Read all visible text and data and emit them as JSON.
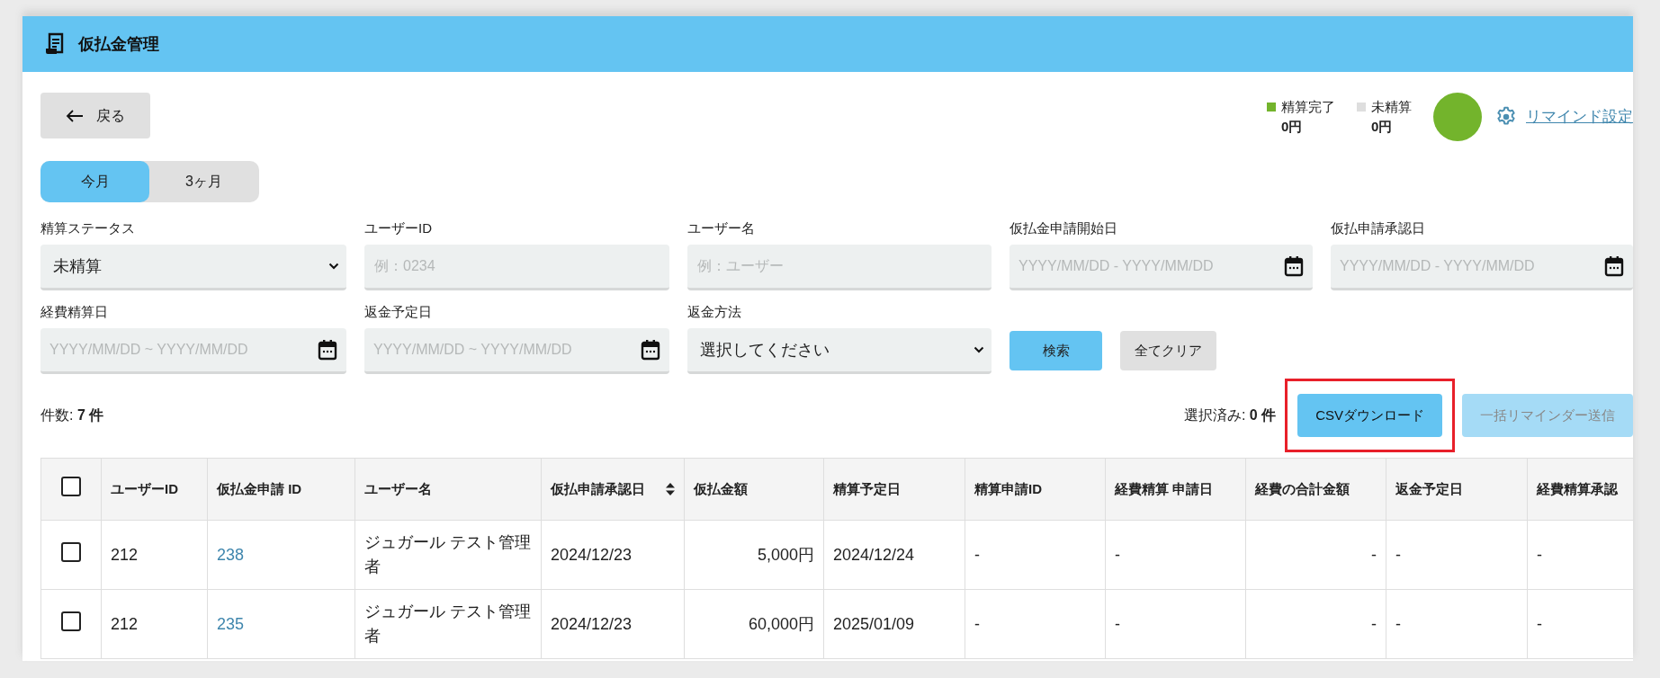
{
  "header": {
    "title": "仮払金管理"
  },
  "back_button": {
    "label": "戻る"
  },
  "summary": {
    "legend": [
      {
        "label": "精算完了",
        "amount": "0円",
        "color": "#73b42c"
      },
      {
        "label": "未精算",
        "amount": "0円",
        "color": "#dedede"
      }
    ],
    "remind_link": "リマインド設定"
  },
  "period_tabs": [
    {
      "label": "今月",
      "selected": true
    },
    {
      "label": "3ヶ月",
      "selected": false
    }
  ],
  "filters": [
    {
      "label": "精算ステータス",
      "kind": "select",
      "value": "未精算"
    },
    {
      "label": "ユーザーID",
      "kind": "text",
      "placeholder": "例：0234"
    },
    {
      "label": "ユーザー名",
      "kind": "text",
      "placeholder": "例：ユーザー"
    },
    {
      "label": "仮払金申請開始日",
      "kind": "date",
      "placeholder": "YYYY/MM/DD - YYYY/MM/DD"
    },
    {
      "label": "仮払申請承認日",
      "kind": "date",
      "placeholder": "YYYY/MM/DD - YYYY/MM/DD"
    },
    {
      "label": "経費精算日",
      "kind": "date",
      "placeholder": "YYYY/MM/DD ~ YYYY/MM/DD"
    },
    {
      "label": "返金予定日",
      "kind": "date",
      "placeholder": "YYYY/MM/DD ~ YYYY/MM/DD"
    },
    {
      "label": "返金方法",
      "kind": "select",
      "value": "選択してください"
    }
  ],
  "search_button": "検索",
  "clear_button": "全てクリア",
  "count": {
    "label": "件数:",
    "value": "7 件"
  },
  "selected_count": {
    "label": "選択済み:",
    "value": "0 件"
  },
  "actions": [
    {
      "label": "CSVダウンロード",
      "disabled": false,
      "highlighted": true
    },
    {
      "label": "一括リマインダー送信",
      "disabled": true,
      "highlighted": false
    }
  ],
  "table": {
    "header_checked": false,
    "columns": [
      {
        "label": "ユーザーID",
        "kind": "text",
        "sortable": false
      },
      {
        "label": "仮払金申請 ID",
        "kind": "link",
        "sortable": false
      },
      {
        "label": "ユーザー名",
        "kind": "text",
        "sortable": false
      },
      {
        "label": "仮払申請承認日",
        "kind": "text",
        "sortable": true
      },
      {
        "label": "仮払金額",
        "kind": "amount",
        "sortable": false
      },
      {
        "label": "精算予定日",
        "kind": "text",
        "sortable": false
      },
      {
        "label": "精算申請ID",
        "kind": "text",
        "sortable": false
      },
      {
        "label": "経費精算 申請日",
        "kind": "text",
        "sortable": false
      },
      {
        "label": "経費の合計金額",
        "kind": "amount",
        "sortable": false
      },
      {
        "label": "返金予定日",
        "kind": "text",
        "sortable": false
      },
      {
        "label": "経費精算承認",
        "kind": "text",
        "sortable": false
      }
    ],
    "rows": [
      {
        "checked": false,
        "cells": [
          "212",
          "238",
          "ジュガール テスト管理者",
          "2024/12/23",
          "5,000円",
          "2024/12/24",
          "-",
          "-",
          "-",
          "-",
          "-"
        ]
      },
      {
        "checked": false,
        "cells": [
          "212",
          "235",
          "ジュガール テスト管理者",
          "2024/12/23",
          "60,000円",
          "2025/01/09",
          "-",
          "-",
          "-",
          "-",
          "-"
        ]
      }
    ]
  }
}
